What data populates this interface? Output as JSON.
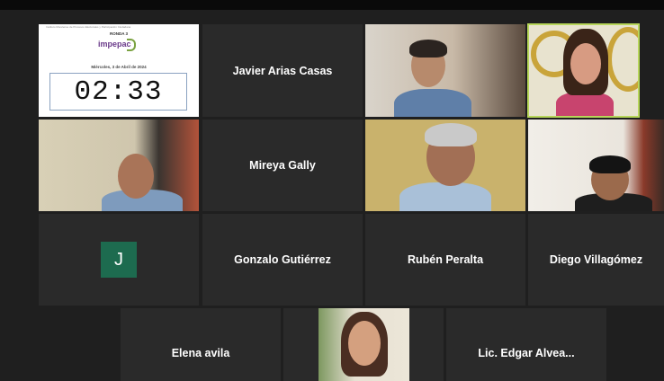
{
  "presentation": {
    "header_text": "Instituto Morelense de Procesos Electorales y Participación Ciudadana",
    "round_label": "RONDA 3",
    "logo_text": "impepac",
    "date_text": "Miércoles, 3 de Abril de 2024",
    "timer": "02:33"
  },
  "participants": [
    {
      "name": "Javier Arias Casas",
      "video": false
    },
    {
      "name": "Mireya Gally",
      "video": false
    },
    {
      "name": "Gonzalo Gutiérrez",
      "video": false
    },
    {
      "name": "Rubén Peralta",
      "video": false
    },
    {
      "name": "Diego Villagómez",
      "video": false
    },
    {
      "name": "Elena avila",
      "video": false
    },
    {
      "name": "Lic. Edgar Alvea...",
      "video": false
    }
  ],
  "avatar_initial": "J",
  "colors": {
    "background": "#1f1f1f",
    "tile": "#2a2a2a",
    "active_speaker_border": "#b7d65a",
    "avatar": "#1d6b4f"
  }
}
